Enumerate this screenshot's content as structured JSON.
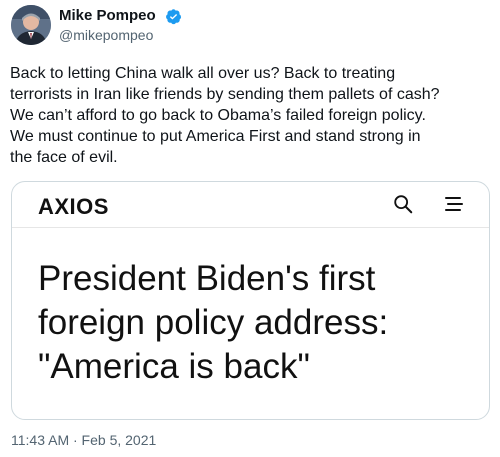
{
  "author": {
    "name": "Mike Pompeo",
    "handle": "@mikepompeo"
  },
  "tweet": {
    "lines": [
      "Back to letting China walk all over us? Back to treating",
      "terrorists in Iran like friends by sending them pallets of cash?",
      "We can’t afford to go back to Obama’s failed foreign policy.",
      "We must continue to put America First and stand strong in",
      "the face of evil."
    ],
    "timestamp": "11:43 AM · Feb 5, 2021"
  },
  "card": {
    "logo": "AXIOS",
    "headline_lines": [
      "President Biden's first",
      "foreign policy address:",
      "\"America is back\""
    ],
    "icons": [
      "search-icon",
      "menu-icon"
    ]
  },
  "colors": {
    "verified": "#1d9bf0",
    "muted_text": "#536471",
    "card_border": "#cfd9de"
  }
}
